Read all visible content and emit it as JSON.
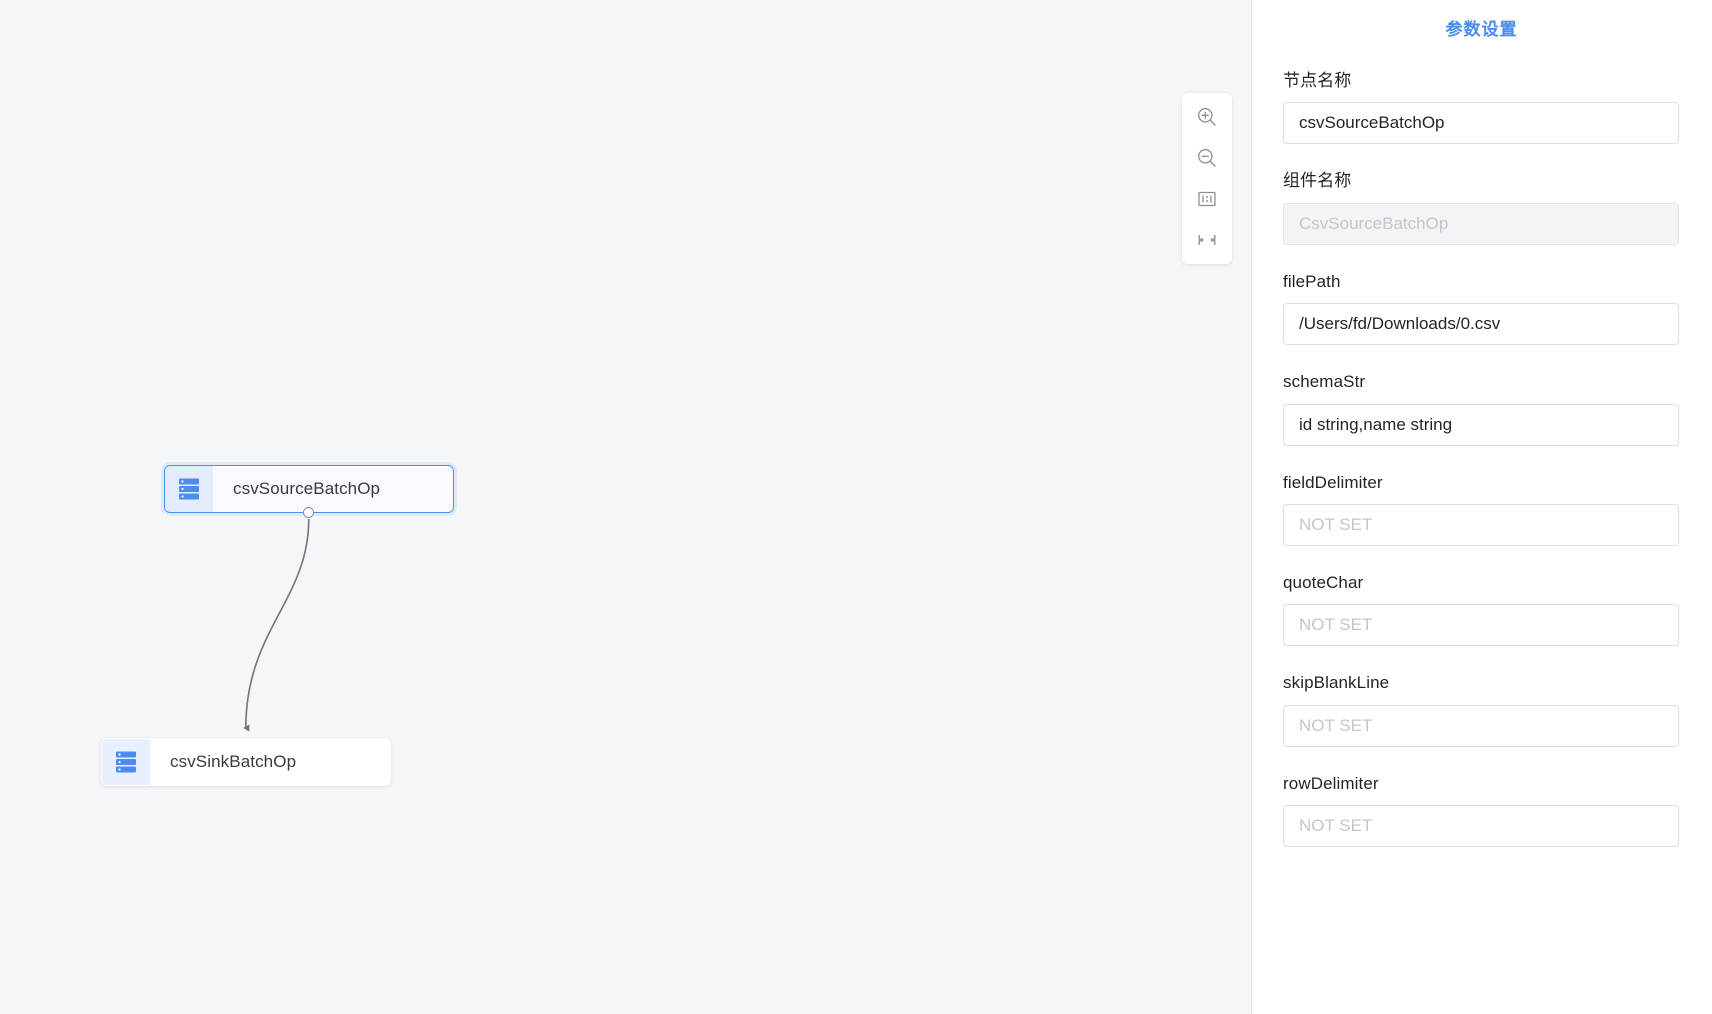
{
  "canvas": {
    "zoom_toolbar": {
      "buttons": [
        {
          "name": "zoom-in-icon",
          "title": "Zoom In"
        },
        {
          "name": "zoom-out-icon",
          "title": "Zoom Out"
        },
        {
          "name": "actual-size-icon",
          "title": "1:1"
        },
        {
          "name": "fit-screen-icon",
          "title": "Fit to Screen"
        }
      ]
    },
    "nodes": [
      {
        "id": "source",
        "label": "csvSourceBatchOp",
        "icon": "database-icon",
        "selected": true
      },
      {
        "id": "sink",
        "label": "csvSinkBatchOp",
        "icon": "database-icon",
        "selected": false
      }
    ],
    "edges": [
      {
        "from": "source",
        "to": "sink"
      }
    ]
  },
  "panel": {
    "title": "参数设置",
    "fields": [
      {
        "key": "nodeName",
        "label": "节点名称",
        "value": "csvSourceBatchOp",
        "placeholder": "",
        "disabled": false
      },
      {
        "key": "componentName",
        "label": "组件名称",
        "value": "",
        "placeholder": "CsvSourceBatchOp",
        "disabled": true
      },
      {
        "key": "filePath",
        "label": "filePath",
        "value": "/Users/fd/Downloads/0.csv",
        "placeholder": "NOT SET",
        "disabled": false
      },
      {
        "key": "schemaStr",
        "label": "schemaStr",
        "value": "id string,name string",
        "placeholder": "NOT SET",
        "disabled": false
      },
      {
        "key": "fieldDelimiter",
        "label": "fieldDelimiter",
        "value": "",
        "placeholder": "NOT SET",
        "disabled": false
      },
      {
        "key": "quoteChar",
        "label": "quoteChar",
        "value": "",
        "placeholder": "NOT SET",
        "disabled": false
      },
      {
        "key": "skipBlankLine",
        "label": "skipBlankLine",
        "value": "",
        "placeholder": "NOT SET",
        "disabled": false
      },
      {
        "key": "rowDelimiter",
        "label": "rowDelimiter",
        "value": "",
        "placeholder": "NOT SET",
        "disabled": false
      }
    ]
  },
  "colors": {
    "accent": "#4a8cf0",
    "node_icon_bg": "#e3ecfd",
    "node_icon_blue": "#4a8cf0",
    "canvas_bg": "#f5f6f8",
    "edge_stroke": "#6f747c",
    "placeholder": "#c2c6cc"
  }
}
